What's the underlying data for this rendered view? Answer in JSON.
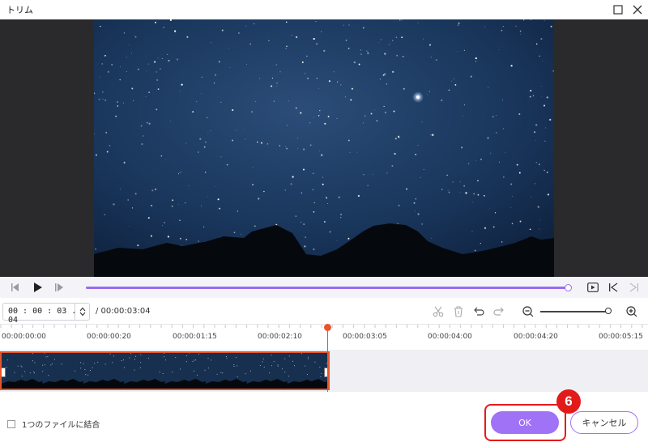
{
  "window": {
    "title": "トリム",
    "maximize_icon": "maximize-icon",
    "close_icon": "close-icon"
  },
  "preview": {
    "description_icon": "video-frame"
  },
  "player": {
    "progress": 1.0,
    "icons": [
      "prev-frame-icon",
      "play-icon",
      "next-frame-icon",
      "preview-clip-icon",
      "mark-in-icon",
      "mark-out-icon"
    ]
  },
  "time": {
    "current": "00 : 00 : 03 . 04",
    "total": "/ 00:00:03:04"
  },
  "tools": {
    "icons": [
      "scissors-icon",
      "delete-icon",
      "undo-icon",
      "redo-icon",
      "zoom-out-icon",
      "zoom-in-icon"
    ],
    "zoom_level": 1.0
  },
  "ruler": {
    "labels": [
      "00:00:00:00",
      "00:00:00:20",
      "00:00:01:15",
      "00:00:02:10",
      "00:00:03:05",
      "00:00:04:00",
      "00:00:04:20",
      "00:00:05:15"
    ]
  },
  "footer": {
    "merge_label": "1つのファイルに結合",
    "ok_label": "OK",
    "cancel_label": "キャンセル",
    "step_badge": "6"
  },
  "colors": {
    "accent": "#9f72f6",
    "highlight": "#e31a1a",
    "clip_border": "#e8552a"
  }
}
